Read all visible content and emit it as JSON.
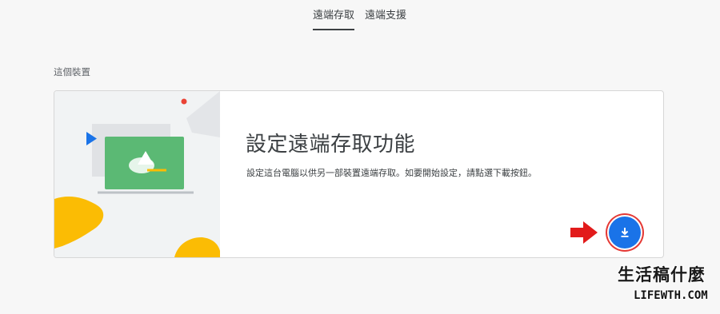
{
  "tabs": [
    {
      "label": "遠端存取",
      "active": true
    },
    {
      "label": "遠端支援",
      "active": false
    }
  ],
  "section": {
    "label": "這個裝置"
  },
  "card": {
    "title": "設定遠端存取功能",
    "description": "設定這台電腦以供另一部裝置遠端存取。如要開始設定，請點選下載按鈕。",
    "download_icon": "download-icon"
  },
  "watermark": {
    "chinese": "生活稿什麼",
    "english": "LIFEWTH.COM"
  },
  "colors": {
    "accent": "#1a73e8",
    "highlight_ring": "#e53935",
    "arrow": "#e21b1b"
  }
}
